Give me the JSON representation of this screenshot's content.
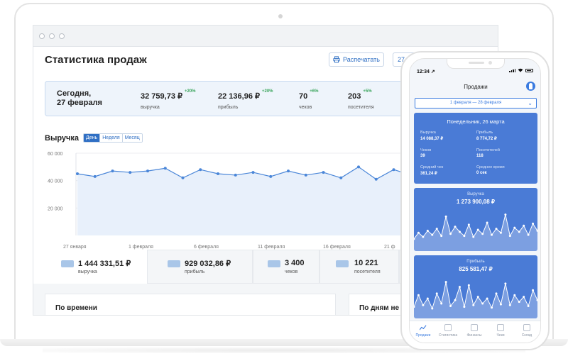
{
  "desktop": {
    "title": "Статистика продаж",
    "print_label": "Распечатать",
    "date_label": "27",
    "summary": {
      "today_line1": "Сегодня,",
      "today_line2": "27 февраля",
      "metrics": [
        {
          "value": "32 759,73 ₽",
          "change": "+20%",
          "label": "выручка"
        },
        {
          "value": "22 136,96 ₽",
          "change": "+20%",
          "label": "прибыль"
        },
        {
          "value": "70",
          "change": "+6%",
          "label": "чеков"
        },
        {
          "value": "203",
          "change": "+5%",
          "label": "посетителя"
        }
      ]
    },
    "revenue": {
      "title": "Выручка",
      "periods": [
        "День",
        "Неделя",
        "Месяц"
      ],
      "active_period": "День"
    },
    "tiles": [
      {
        "value": "1 444 331,51 ₽",
        "label": "выручка"
      },
      {
        "value": "929 032,86 ₽",
        "label": "прибыль"
      },
      {
        "value": "3 400",
        "label": "чеков"
      },
      {
        "value": "10 221",
        "label": "посетителя"
      }
    ],
    "panels": [
      "По времени",
      "По дням не"
    ]
  },
  "chart_data": [
    {
      "type": "area",
      "y_ticks": [
        "60 000",
        "40 000",
        "20 000"
      ],
      "ylim": [
        0,
        60000
      ],
      "x_ticks": [
        "27 января",
        "1 февраля",
        "6 февраля",
        "11 февраля",
        "16 февраля",
        "21 ф"
      ],
      "series": [
        {
          "values": [
            45000,
            43000,
            47000,
            46000,
            47000,
            49000,
            42000,
            48000,
            45000,
            44000,
            46000,
            43000,
            47000,
            44000,
            46000,
            42000,
            50000,
            41000,
            48000,
            44000,
            46000,
            42000,
            47000,
            45000,
            44000
          ]
        }
      ],
      "color": "#4a86d8"
    },
    {
      "type": "area",
      "title": "Выручка",
      "series": [
        {
          "values": [
            12,
            18,
            14,
            20,
            16,
            22,
            15,
            34,
            17,
            24,
            19,
            15,
            26,
            14,
            21,
            17,
            28,
            16,
            22,
            18,
            36,
            15,
            23,
            19,
            25,
            16,
            27,
            20
          ]
        }
      ]
    },
    {
      "type": "area",
      "title": "Прибыль",
      "series": [
        {
          "values": [
            14,
            28,
            16,
            24,
            12,
            30,
            18,
            44,
            15,
            22,
            38,
            14,
            40,
            16,
            26,
            18,
            24,
            13,
            30,
            17,
            42,
            16,
            28,
            20,
            26,
            15,
            34,
            22
          ]
        }
      ]
    }
  ],
  "phone": {
    "time": "12:34",
    "title": "Продажи",
    "date_range": "1 февраля — 28 февраля",
    "day_card": {
      "title": "Понедельник, 26 марта",
      "items": [
        {
          "label": "Выручка",
          "value": "14 088,37 ₽"
        },
        {
          "label": "Прибыль",
          "value": "8 774,72 ₽"
        },
        {
          "label": "Чеков",
          "value": "39"
        },
        {
          "label": "Посетителей",
          "value": "118"
        },
        {
          "label": "Средний чек",
          "value": "361,24 ₽"
        },
        {
          "label": "Среднее время",
          "value": "0 сек"
        }
      ]
    },
    "revenue_card": {
      "title": "Выручка",
      "value": "1 273 900,08 ₽"
    },
    "profit_card": {
      "title": "Прибыль",
      "value": "825 581,47 ₽"
    },
    "tabs": [
      "Продажи",
      "Статистика",
      "Финансы",
      "Чеки",
      "Склад"
    ],
    "active_tab": "Продажи"
  }
}
